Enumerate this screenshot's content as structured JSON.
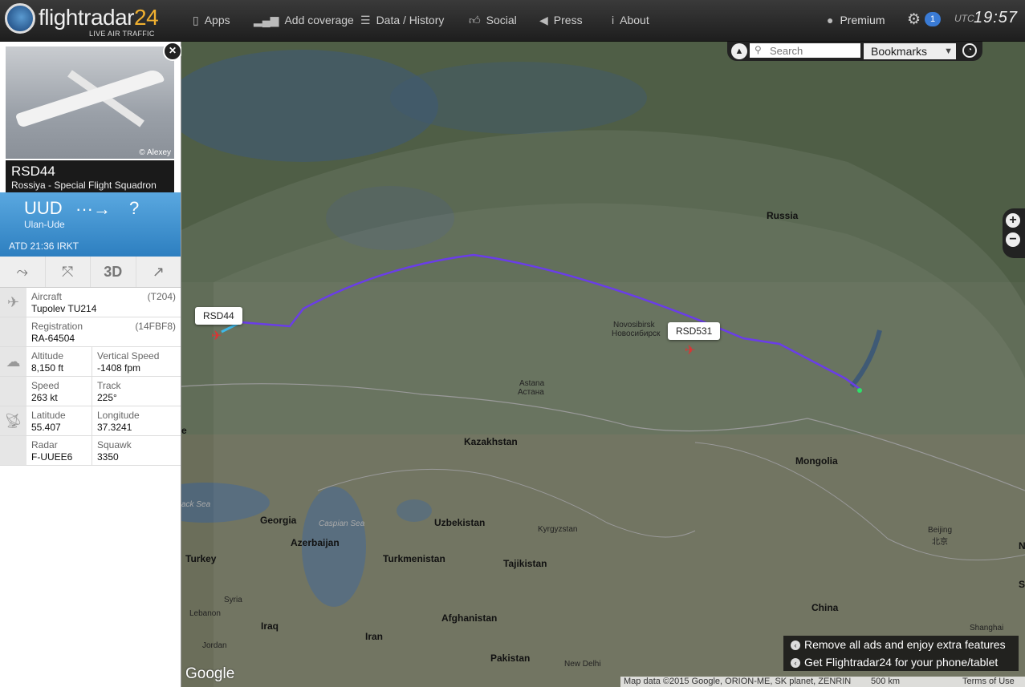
{
  "brand": {
    "name_part1": "flightradar",
    "name_part2": "24",
    "tagline": "LIVE AIR TRAFFIC"
  },
  "nav": [
    {
      "label": "Apps",
      "icon": "mobile-icon"
    },
    {
      "label": "Add coverage",
      "icon": "signal-bars-icon"
    },
    {
      "label": "Data / History",
      "icon": "database-icon"
    },
    {
      "label": "Social",
      "icon": "thumbs-up-icon"
    },
    {
      "label": "Press",
      "icon": "megaphone-icon"
    },
    {
      "label": "About",
      "icon": "info-icon"
    }
  ],
  "account": {
    "premium_label": "Premium",
    "settings_badge": "1"
  },
  "clock": {
    "zone": "UTC",
    "time": "19:57"
  },
  "flight": {
    "photo_credit": "© Alexey",
    "callsign": "RSD44",
    "airline": "Rossiya - Special Flight Squadron",
    "from_code": "UUD",
    "from_city": "Ulan-Ude",
    "arrow": "···→",
    "to_code": "?",
    "atd": "ATD 21:36 IRKT"
  },
  "tools": {
    "route_icon": "route-icon",
    "collapse_icon": "collapse-icon",
    "view3d_label": "3D",
    "share_icon": "share-icon"
  },
  "details": {
    "aircraft_label": "Aircraft",
    "aircraft_code": "(T204)",
    "aircraft_value": "Tupolev TU214",
    "registration_label": "Registration",
    "registration_code": "(14FBF8)",
    "registration_value": "RA-64504",
    "altitude_label": "Altitude",
    "altitude_value": "8,150 ft",
    "vspeed_label": "Vertical Speed",
    "vspeed_value": "-1408 fpm",
    "speed_label": "Speed",
    "speed_value": "263 kt",
    "track_label": "Track",
    "track_value": "225°",
    "latitude_label": "Latitude",
    "latitude_value": "55.407",
    "longitude_label": "Longitude",
    "longitude_value": "37.3241",
    "radar_label": "Radar",
    "radar_value": "F-UUEE6",
    "squawk_label": "Squawk",
    "squawk_value": "3350"
  },
  "search": {
    "placeholder": "Search",
    "bookmarks_label": "Bookmarks"
  },
  "map": {
    "labels": {
      "russia": "Russia",
      "kazakhstan": "Kazakhstan",
      "mongolia": "Mongolia",
      "uzbekistan": "Uzbekistan",
      "turkmenistan": "Turkmenistan",
      "tajikistan": "Tajikistan",
      "kyrgyzstan": "Kyrgyzstan",
      "georgia": "Georgia",
      "azerbaijan": "Azerbaijan",
      "turkey": "Turkey",
      "syria": "Syria",
      "lebanon": "Lebanon",
      "iraq": "Iraq",
      "jordan": "Jordan",
      "iran": "Iran",
      "afghanistan": "Afghanistan",
      "pakistan": "Pakistan",
      "new_delhi": "New Delhi",
      "china": "China",
      "beijing": "Beijing",
      "beijing_cn": "北京",
      "shanghai": "Shanghai",
      "novosibirsk": "Novosibirsk",
      "novosibirsk_ru": "Новосибирск",
      "astana": "Astana",
      "astana_ru": "Астана",
      "caspian_sea": "Caspian Sea",
      "black_sea": "ack Sea",
      "edge_e": "e",
      "edge_n": "N",
      "edge_s": "S"
    },
    "flights": [
      {
        "callsign": "RSD44"
      },
      {
        "callsign": "RSD531"
      }
    ],
    "track_color": "#6a3de8"
  },
  "promo": {
    "remove_ads": "Remove all ads and enjoy extra features",
    "get_app": "Get Flightradar24 for your phone/tablet"
  },
  "attribution": {
    "data": "Map data ©2015 Google, ORION-ME, SK planet, ZENRIN",
    "scale": "500 km",
    "terms": "Terms of Use"
  },
  "google_logo": "Google"
}
